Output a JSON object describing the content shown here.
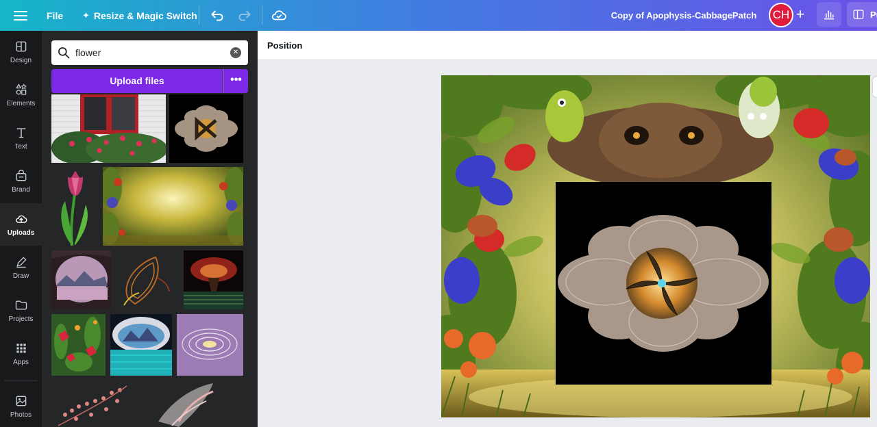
{
  "topbar": {
    "file_label": "File",
    "resize_label": "Resize & Magic Switch",
    "doc_title": "Copy of Apophysis-CabbagePatch",
    "avatar_initials": "CH",
    "present_label": "Pu",
    "brand_gradient": [
      "#16b6c8",
      "#3f7fe0",
      "#6b52e8"
    ]
  },
  "rail": {
    "items": [
      {
        "label": "Design",
        "icon": "design-icon"
      },
      {
        "label": "Elements",
        "icon": "elements-icon"
      },
      {
        "label": "Text",
        "icon": "text-icon"
      },
      {
        "label": "Brand",
        "icon": "brand-icon"
      },
      {
        "label": "Uploads",
        "icon": "uploads-icon",
        "active": true
      },
      {
        "label": "Draw",
        "icon": "draw-icon"
      },
      {
        "label": "Projects",
        "icon": "projects-icon"
      },
      {
        "label": "Apps",
        "icon": "apps-icon"
      },
      {
        "label": "Photos",
        "icon": "photos-icon"
      }
    ]
  },
  "panel": {
    "search_value": "flower",
    "upload_label": "Upload files",
    "more_label": "•••"
  },
  "context_bar": {
    "position_label": "Position"
  },
  "colors": {
    "accent_purple": "#7d2ae8",
    "avatar_red": "#e01b3c",
    "rail_bg": "#18191b",
    "panel_bg": "#252627"
  }
}
